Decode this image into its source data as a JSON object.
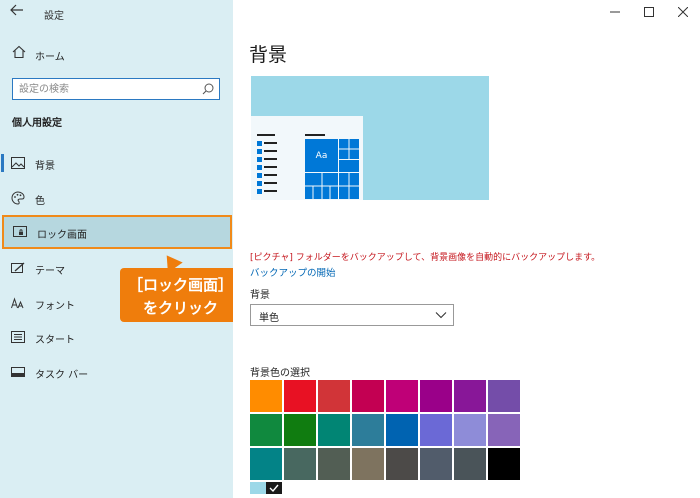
{
  "app": {
    "title": "設定",
    "back_icon": "back-arrow-icon",
    "controls": {
      "minimize": "minimize-icon",
      "maximize": "maximize-icon",
      "close": "close-icon"
    }
  },
  "sidebar": {
    "home_label": "ホーム",
    "search_placeholder": "設定の検索",
    "section_title": "個人用設定",
    "items": [
      {
        "label": "背景",
        "icon": "picture-icon",
        "state": "current"
      },
      {
        "label": "色",
        "icon": "palette-icon",
        "state": "normal"
      },
      {
        "label": "ロック画面",
        "icon": "lock-screen-icon",
        "state": "highlighted"
      },
      {
        "label": "テーマ",
        "icon": "theme-brush-icon",
        "state": "normal"
      },
      {
        "label": "フォント",
        "icon": "font-icon",
        "state": "normal"
      },
      {
        "label": "スタート",
        "icon": "start-icon",
        "state": "normal"
      },
      {
        "label": "タスク バー",
        "icon": "taskbar-icon",
        "state": "normal"
      }
    ]
  },
  "callout": {
    "line1": "［ロック画面］",
    "line2": "をクリック"
  },
  "main": {
    "page_title": "背景",
    "preview": {
      "tile_label": "Aa"
    },
    "warning": "[ピクチャ] フォルダーをバックアップして、背景画像を自動的にバックアップします。",
    "backup_link": "バックアップの開始",
    "background_label": "背景",
    "background_value": "単色",
    "color_label": "背景色の選択"
  },
  "colors": {
    "accent": "#2b79c2",
    "highlight_border": "#f08a1a",
    "callout_bg": "#ef7d0c",
    "preview_bg": "#9cd8e8",
    "tile_blue": "#0078d7",
    "warning_red": "#c5161d",
    "link_blue": "#0066b4",
    "sidebar_bg": "#daeef3"
  },
  "swatches": [
    [
      "#ff8c00",
      "#e81123",
      "#d13438",
      "#c30052",
      "#bf0077",
      "#9a0089",
      "#881798",
      "#744da9"
    ],
    [
      "#10893e",
      "#107c10",
      "#018574",
      "#2d7d9a",
      "#0063b1",
      "#6b69d6",
      "#8e8cd8",
      "#8764b8"
    ],
    [
      "#038387",
      "#486860",
      "#525e54",
      "#7e735f",
      "#4c4a48",
      "#515c6b",
      "#4a5459",
      "#000000"
    ],
    [
      "#9cd8e8"
    ]
  ],
  "selected_swatch_icon": "checkmark-icon"
}
